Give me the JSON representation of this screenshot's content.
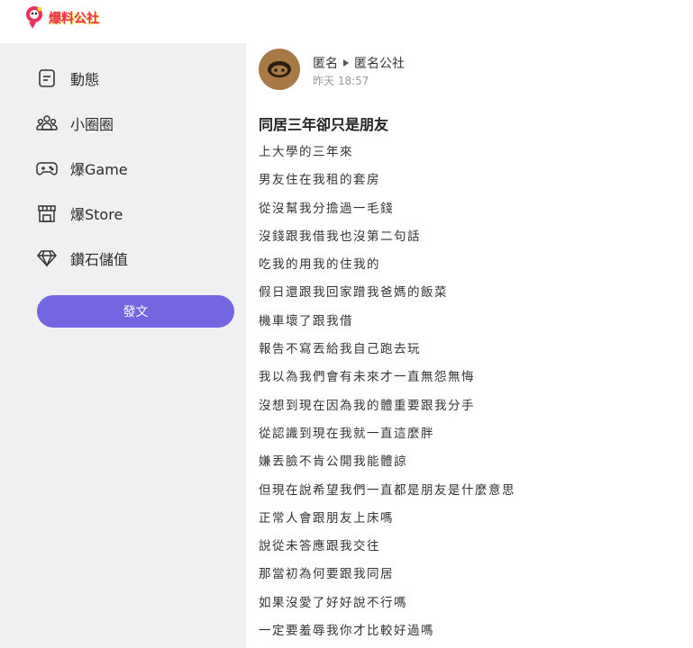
{
  "header": {
    "logo_text": "爆料公社",
    "logo_icon": "mascot-logo"
  },
  "sidebar": {
    "items": [
      {
        "label": "動態",
        "icon": "feed-icon"
      },
      {
        "label": "小圈圈",
        "icon": "groups-icon"
      },
      {
        "label": "爆Game",
        "icon": "gamepad-icon"
      },
      {
        "label": "爆Store",
        "icon": "store-icon"
      },
      {
        "label": "鑽石儲值",
        "icon": "diamond-icon"
      }
    ],
    "post_button_label": "發文"
  },
  "post": {
    "author": "匿名",
    "board": "匿名公社",
    "time": "昨天 18:57",
    "title": "同居三年卻只是朋友",
    "lines": [
      "上大學的三年來",
      "男友住在我租的套房",
      "從沒幫我分擔過一毛錢",
      "沒錢跟我借我也沒第二句話",
      "吃我的用我的住我的",
      "假日還跟我回家蹭我爸媽的飯菜",
      "機車壞了跟我借",
      "報告不寫丟給我自己跑去玩",
      "我以為我們會有未來才一直無怨無悔",
      "沒想到現在因為我的體重要跟我分手",
      "從認識到現在我就一直這麼胖",
      "嫌丟臉不肯公開我能體諒",
      "但現在說希望我們一直都是朋友是什麼意思",
      "正常人會跟朋友上床嗎",
      "說從未答應跟我交往",
      "那當初為何要跟我同居",
      "如果沒愛了好好說不行嗎",
      "一定要羞辱我你才比較好過嗎"
    ]
  },
  "colors": {
    "accent": "#7466e0",
    "sidebar_bg": "#f0f0f2",
    "avatar_bg": "#a77946",
    "logo_red": "#e8325c"
  }
}
